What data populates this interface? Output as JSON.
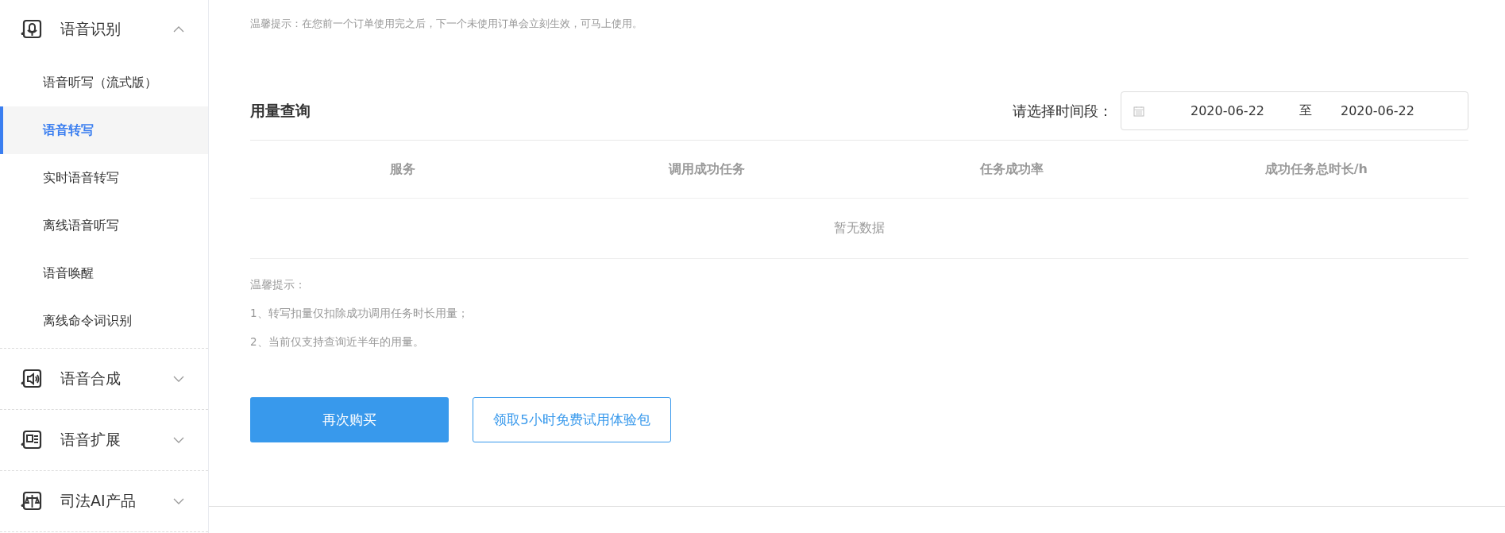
{
  "sidebar": {
    "groups": [
      {
        "label": "语音识别",
        "expanded": true,
        "items": [
          {
            "label": "语音听写（流式版）",
            "selected": false
          },
          {
            "label": "语音转写",
            "selected": true
          },
          {
            "label": "实时语音转写",
            "selected": false
          },
          {
            "label": "离线语音听写",
            "selected": false
          },
          {
            "label": "语音唤醒",
            "selected": false
          },
          {
            "label": "离线命令词识别",
            "selected": false
          }
        ]
      },
      {
        "label": "语音合成",
        "expanded": false
      },
      {
        "label": "语音扩展",
        "expanded": false
      },
      {
        "label": "司法AI产品",
        "expanded": false
      }
    ]
  },
  "top_tip": "温馨提示：在您前一个订单使用完之后，下一个未使用订单会立刻生效，可马上使用。",
  "usage": {
    "title": "用量查询",
    "range_label": "请选择时间段：",
    "start_date": "2020-06-22",
    "separator": "至",
    "end_date": "2020-06-22",
    "columns": [
      "服务",
      "调用成功任务",
      "任务成功率",
      "成功任务总时长/h"
    ],
    "empty_text": "暂无数据",
    "notes": [
      "温馨提示：",
      "1、转写扣量仅扣除成功调用任务时长用量；",
      "2、当前仅支持查询近半年的用量。"
    ]
  },
  "buttons": [
    {
      "label": "再次购买",
      "kind": "primary"
    },
    {
      "label": "领取5小时免费试用体验包",
      "kind": "outline"
    }
  ]
}
